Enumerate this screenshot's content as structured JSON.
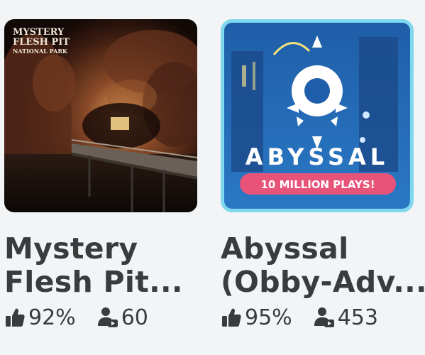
{
  "games": [
    {
      "title_line1": "Mystery",
      "title_line2": "Flesh Pit...",
      "thumb_text_line1": "MYSTERY",
      "thumb_text_line2": "FLESH PIT",
      "thumb_text_line3": "NATIONAL PARK",
      "rating": "92%",
      "players": "60",
      "rating_icon": "thumbs-up-icon",
      "players_icon": "players-icon"
    },
    {
      "title_line1": "Abyssal",
      "title_line2": "(Obby-Adv...",
      "thumb_title": "ABYSSAL",
      "thumb_banner": "10 MILLION PLAYS!",
      "rating": "95%",
      "players": "453",
      "rating_icon": "thumbs-up-icon",
      "players_icon": "players-icon"
    }
  ],
  "colors": {
    "background": "#f2f4f5",
    "text": "#393b3d",
    "selected_border": "#7fd8ee",
    "banner_pink": "#e8537a"
  }
}
